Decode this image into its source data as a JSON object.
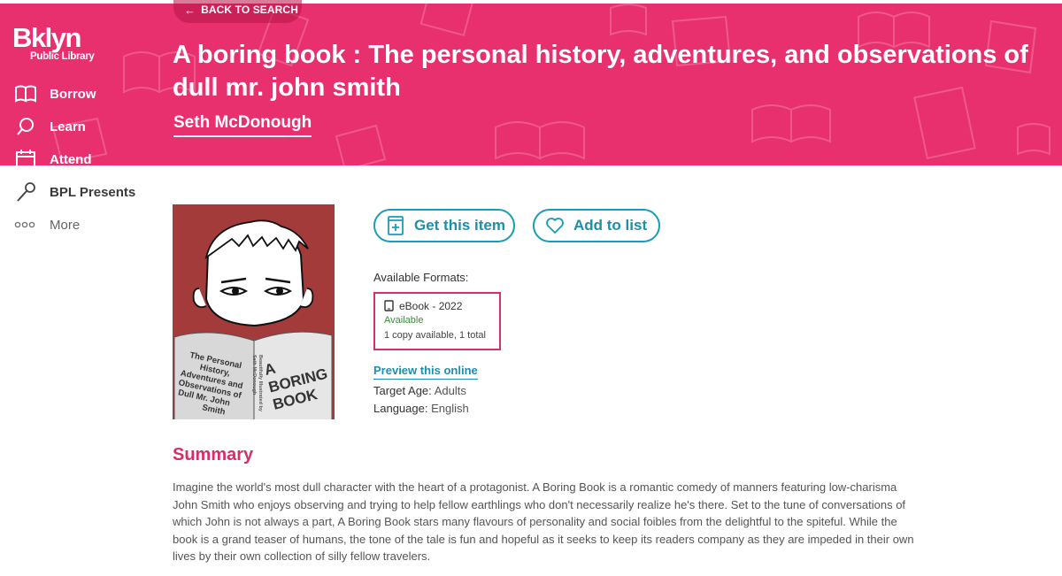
{
  "header": {
    "back_label": "BACK TO SEARCH",
    "title": "A boring book : The personal history, adventures, and observations of dull mr. john smith",
    "author": "Seth McDonough"
  },
  "logo": {
    "line1": "Bklyn",
    "line2": "Public Library"
  },
  "sidebar": {
    "items": [
      {
        "label": "Borrow",
        "icon": "book-icon"
      },
      {
        "label": "Learn",
        "icon": "lightbulb-icon"
      },
      {
        "label": "Attend",
        "icon": "calendar-icon"
      },
      {
        "label": "BPL Presents",
        "icon": "microphone-icon"
      },
      {
        "label": "More",
        "icon": "more-dots-icon"
      }
    ]
  },
  "cover": {
    "title_lines": [
      "A",
      "BORING",
      "BOOK"
    ],
    "subtitle_lines": [
      "The Personal",
      "History,",
      "Adventures and",
      "Observations of",
      "Dull Mr. John",
      "Smith"
    ],
    "spine_lines": [
      "Beautifully Illustrated by",
      "Seth McDonough"
    ]
  },
  "actions": {
    "get_label": "Get this item",
    "add_label": "Add to list"
  },
  "formats": {
    "label": "Available Formats:",
    "items": [
      {
        "name": "eBook - 2022",
        "status": "Available",
        "copies": "1 copy available, 1 total"
      }
    ]
  },
  "preview_label": "Preview this online",
  "details": {
    "target_age_label": "Target Age:",
    "target_age": "Adults",
    "language_label": "Language:",
    "language": "English"
  },
  "summary": {
    "heading": "Summary",
    "text": "Imagine the world's most dull character with the heart of a protagonist. A Boring Book is a romantic comedy of manners featuring low-charisma John Smith who enjoys observing and trying to help fellow earthlings who don't necessarily realize he's there. Set to the tune of conversations of which John is not always a part, A Boring Book stars many flavours of personality and social foibles from the delightful to the spiteful. While the book is a grand teaser of humans, the tone of the tale is fun and hopeful as it seeks to keep its readers company as they are impeded in their own lives by their own collection of silly fellow travelers."
  },
  "colors": {
    "brand_pink": "#e8306f",
    "accent_teal": "#1a9cb8",
    "heading_pink": "#d62e67",
    "available_green": "#3c8a3c"
  }
}
